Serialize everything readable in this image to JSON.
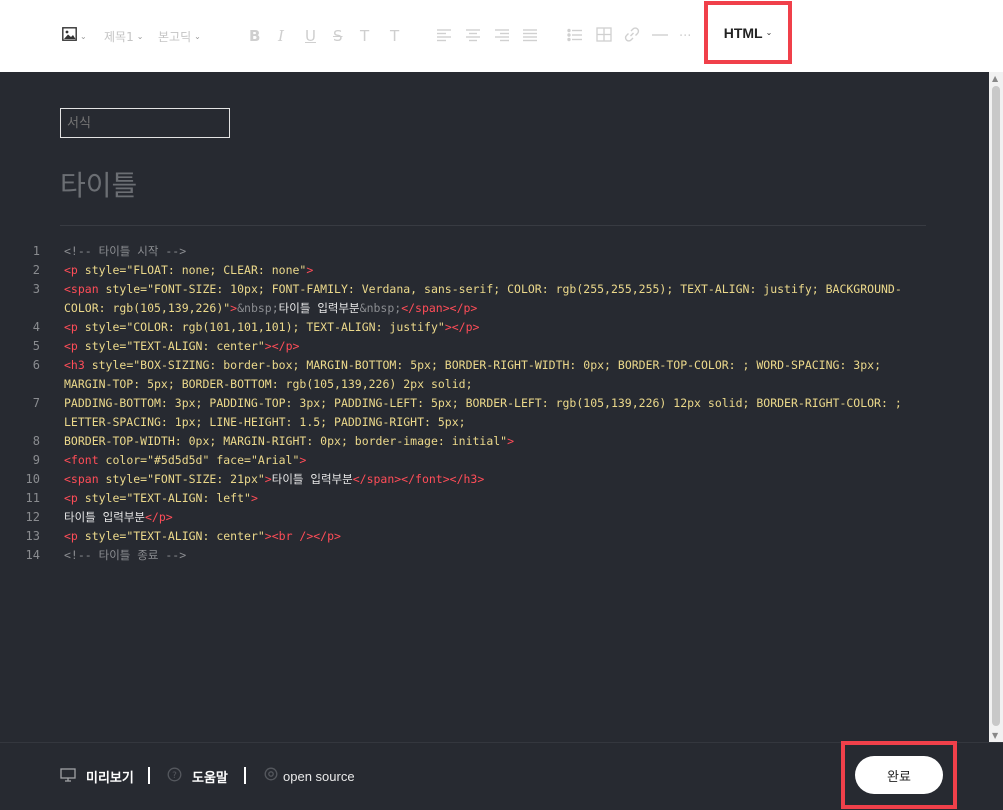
{
  "toolbar": {
    "image_icon": "image-icon",
    "heading_label": "제목1",
    "font_label": "본고딕",
    "format_icons": [
      "bold-icon",
      "italic-icon",
      "underline-icon",
      "strikethrough-icon",
      "text-color-icon",
      "text-bg-color-icon"
    ],
    "align_icons": [
      "align-left-icon",
      "align-center-icon",
      "align-right-icon",
      "align-justify-icon"
    ],
    "insert_icons": [
      "list-icon",
      "table-icon",
      "link-icon",
      "horizontal-rule-icon",
      "more-icon"
    ],
    "mode_label": "HTML"
  },
  "editor": {
    "format_placeholder": "서식",
    "title": "타이틀",
    "lines": [
      {
        "n": "1",
        "tokens": [
          [
            "comment",
            "<!-- 타이틀 시작 -->"
          ]
        ]
      },
      {
        "n": "2",
        "tokens": [
          [
            "tag",
            "<p "
          ],
          [
            "attr",
            "style=\"FLOAT: none; CLEAR: none\""
          ],
          [
            "tag",
            ">"
          ]
        ]
      },
      {
        "n": "3",
        "tokens": [
          [
            "tag",
            "<span "
          ],
          [
            "attr",
            "style=\"FONT-SIZE: 10px; FONT-FAMILY: Verdana, sans-serif; COLOR: rgb(255,255,255); TEXT-ALIGN: justify; BACKGROUND-COLOR: rgb(105,139,226)\""
          ],
          [
            "tag",
            ">"
          ],
          [
            "ent",
            "&nbsp;"
          ],
          [
            "text",
            "타이틀 입력부분"
          ],
          [
            "ent",
            "&nbsp;"
          ],
          [
            "tag",
            "</span></p>"
          ]
        ]
      },
      {
        "n": "4",
        "tokens": [
          [
            "tag",
            "<p "
          ],
          [
            "attr",
            "style=\"COLOR: rgb(101,101,101); TEXT-ALIGN: justify\""
          ],
          [
            "tag",
            "></p>"
          ]
        ]
      },
      {
        "n": "5",
        "tokens": [
          [
            "tag",
            "<p "
          ],
          [
            "attr",
            "style=\"TEXT-ALIGN: center\""
          ],
          [
            "tag",
            "></p>"
          ]
        ]
      },
      {
        "n": "6",
        "tokens": [
          [
            "tag",
            "<h3 "
          ],
          [
            "attr",
            "style=\"BOX-SIZING: border-box; MARGIN-BOTTOM: 5px; BORDER-RIGHT-WIDTH: 0px; BORDER-TOP-COLOR: ; WORD-SPACING: 3px; MARGIN-TOP: 5px; BORDER-BOTTOM: rgb(105,139,226) 2px solid;"
          ]
        ]
      },
      {
        "n": "7",
        "tokens": [
          [
            "attr",
            "PADDING-BOTTOM: 3px; PADDING-TOP: 3px; PADDING-LEFT: 5px; BORDER-LEFT: rgb(105,139,226) 12px solid; BORDER-RIGHT-COLOR: ; LETTER-SPACING: 1px; LINE-HEIGHT: 1.5; PADDING-RIGHT: 5px;"
          ]
        ]
      },
      {
        "n": "8",
        "tokens": [
          [
            "attr",
            "BORDER-TOP-WIDTH: 0px; MARGIN-RIGHT: 0px; border-image: initial\""
          ],
          [
            "tag",
            ">"
          ]
        ]
      },
      {
        "n": "9",
        "tokens": [
          [
            "tag",
            "<font "
          ],
          [
            "attr",
            "color=\"#5d5d5d\" face=\"Arial\""
          ],
          [
            "tag",
            ">"
          ]
        ]
      },
      {
        "n": "10",
        "tokens": [
          [
            "tag",
            "<span "
          ],
          [
            "attr",
            "style=\"FONT-SIZE: 21px\""
          ],
          [
            "tag",
            ">"
          ],
          [
            "text",
            "타이틀 입력부분"
          ],
          [
            "tag",
            "</span></font></h3>"
          ]
        ]
      },
      {
        "n": "11",
        "tokens": [
          [
            "tag",
            "<p "
          ],
          [
            "attr",
            "style=\"TEXT-ALIGN: left\""
          ],
          [
            "tag",
            ">"
          ]
        ]
      },
      {
        "n": "12",
        "tokens": [
          [
            "text",
            "타이틀 입력부분"
          ],
          [
            "tag",
            "</p>"
          ]
        ]
      },
      {
        "n": "13",
        "tokens": [
          [
            "tag",
            "<p "
          ],
          [
            "attr",
            "style=\"TEXT-ALIGN: center\""
          ],
          [
            "tag",
            "><br /></p>"
          ]
        ]
      },
      {
        "n": "14",
        "tokens": [
          [
            "comment",
            "<!-- 타이틀 종료 -->"
          ]
        ]
      }
    ]
  },
  "footer": {
    "preview_label": "미리보기",
    "help_label": "도움말",
    "oss_label": "open source",
    "done_label": "완료"
  },
  "colors": {
    "highlight": "#f0404a",
    "editor_bg": "#272a31",
    "tag": "#ff4d58",
    "attr": "#ecd98b",
    "comment": "#8b8d91"
  }
}
